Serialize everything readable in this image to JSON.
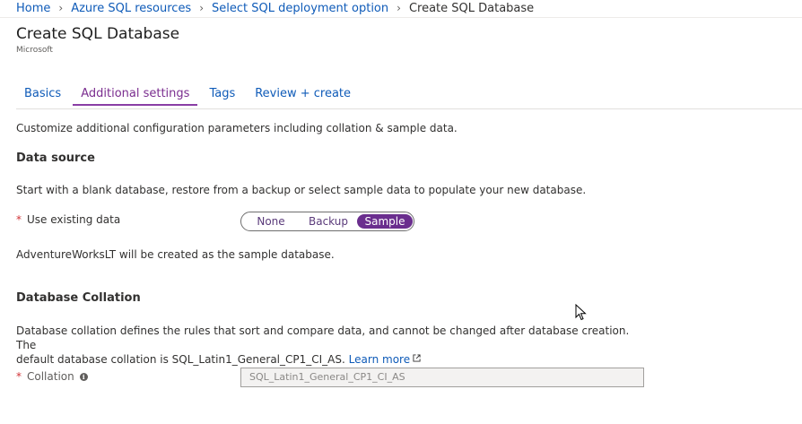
{
  "breadcrumb": {
    "items": [
      "Home",
      "Azure SQL resources",
      "Select SQL deployment option"
    ],
    "current": "Create SQL Database"
  },
  "header": {
    "title": "Create SQL Database",
    "publisher": "Microsoft"
  },
  "tabs": [
    {
      "label": "Basics",
      "active": false
    },
    {
      "label": "Additional settings",
      "active": true
    },
    {
      "label": "Tags",
      "active": false
    },
    {
      "label": "Review + create",
      "active": false
    }
  ],
  "intro": "Customize additional configuration parameters including collation & sample data.",
  "data_source": {
    "heading": "Data source",
    "description": "Start with a blank database, restore from a backup or select sample data to populate your new database.",
    "field_label": "Use existing data",
    "required_mark": "*",
    "options": [
      "None",
      "Backup",
      "Sample"
    ],
    "selected": "Sample",
    "note": "AdventureWorksLT will be created as the sample database."
  },
  "collation": {
    "heading": "Database Collation",
    "description_line1": "Database collation defines the rules that sort and compare data, and cannot be changed after database creation. The",
    "description_line2": "default database collation is SQL_Latin1_General_CP1_CI_AS.",
    "learn_more": "Learn more",
    "field_label": "Collation",
    "required_mark": "*",
    "info_icon_glyph": "i",
    "value": "SQL_Latin1_General_CP1_CI_AS"
  },
  "icons": {
    "breadcrumb_separator": "chevron-right-icon",
    "external_link": "external-link-icon",
    "info": "info-icon",
    "cursor": "mouse-pointer-icon"
  },
  "colors": {
    "link": "#0f5bb8",
    "active_tab": "#7a2d8f",
    "toggle_selected": "#6a2e8e",
    "required": "#d13438"
  }
}
